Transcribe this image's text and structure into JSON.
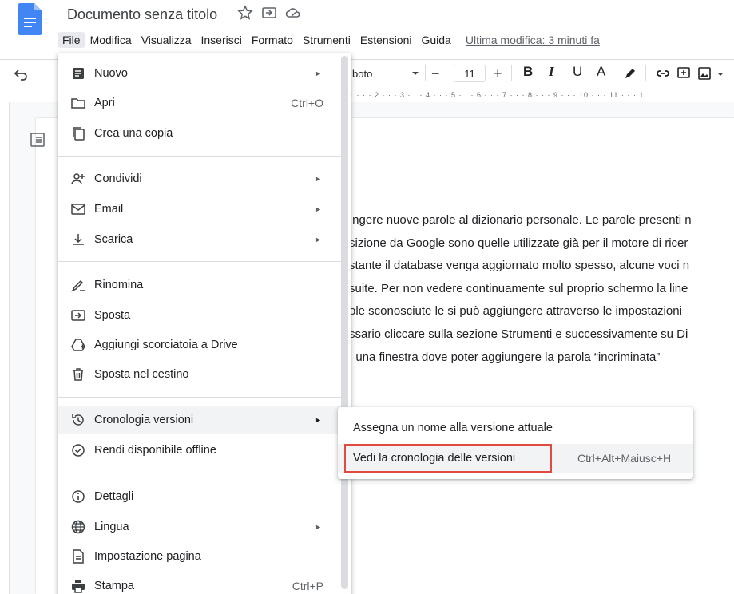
{
  "doc": {
    "title": "Documento senza titolo",
    "title_icons": [
      "star-icon",
      "move-folder-icon",
      "cloud-status-icon"
    ]
  },
  "menubar": {
    "items": [
      "File",
      "Modifica",
      "Visualizza",
      "Inserisci",
      "Formato",
      "Strumenti",
      "Estensioni",
      "Guida"
    ],
    "last_edit": "Ultima modifica: 3 minuti fa"
  },
  "toolbar": {
    "font_name": "boto",
    "font_size": "11",
    "minus": "−",
    "plus": "+",
    "bold": "B",
    "italic": "I",
    "underline": "U",
    "text_color": "A"
  },
  "ruler": "1 · · · 2 · · · 3 · · · 4 · · · 5 · · · 6 · · · 7 · · · 8 · · · 9 · · · 10 · · · 11 · · · 1",
  "body_lines": [
    "ıngere nuove parole al dizionario personale. Le parole presenti n",
    "sizione da Google sono quelle utilizzate già per il motore di ricer",
    "stante il database venga aggiornato molto spesso, alcune voci n",
    "suite. Per non vedere continuamente sul proprio schermo la line",
    "ole sconosciute le si può aggiungere attraverso le impostazioni",
    "ssario cliccare sulla sezione Strumenti e successivamente su Di",
    "ı una finestra dove poter aggiungere la parola “incriminata”"
  ],
  "file_menu": {
    "items": [
      {
        "label": "Nuovo",
        "icon": "document-icon",
        "arrow": "►"
      },
      {
        "label": "Apri",
        "icon": "folder-icon",
        "shortcut": "Ctrl+O"
      },
      {
        "label": "Crea una copia",
        "icon": "copy-icon"
      },
      {
        "label": "Condividi",
        "icon": "share-person-icon",
        "arrow": "►"
      },
      {
        "label": "Email",
        "icon": "email-icon",
        "arrow": "►"
      },
      {
        "label": "Scarica",
        "icon": "download-icon",
        "arrow": "►"
      },
      {
        "label": "Rinomina",
        "icon": "rename-icon"
      },
      {
        "label": "Sposta",
        "icon": "move-icon"
      },
      {
        "label": "Aggiungi scorciatoia a Drive",
        "icon": "drive-shortcut-icon"
      },
      {
        "label": "Sposta nel cestino",
        "icon": "trash-icon"
      },
      {
        "label": "Cronologia versioni",
        "icon": "history-icon",
        "arrow": "►"
      },
      {
        "label": "Rendi disponibile offline",
        "icon": "offline-icon"
      },
      {
        "label": "Dettagli",
        "icon": "info-icon"
      },
      {
        "label": "Lingua",
        "icon": "globe-icon",
        "arrow": "►"
      },
      {
        "label": "Impostazione pagina",
        "icon": "page-setup-icon"
      },
      {
        "label": "Stampa",
        "icon": "print-icon",
        "shortcut": "Ctrl+P"
      }
    ]
  },
  "version_submenu": {
    "items": [
      {
        "label": "Assegna un nome alla versione attuale"
      },
      {
        "label": "Vedi la cronologia delle versioni",
        "shortcut": "Ctrl+Alt+Maiusc+H"
      }
    ]
  },
  "colors": {
    "accent": "#1a73e8",
    "highlight_box": "#e04a3f",
    "docs_blue": "#4285f4"
  }
}
